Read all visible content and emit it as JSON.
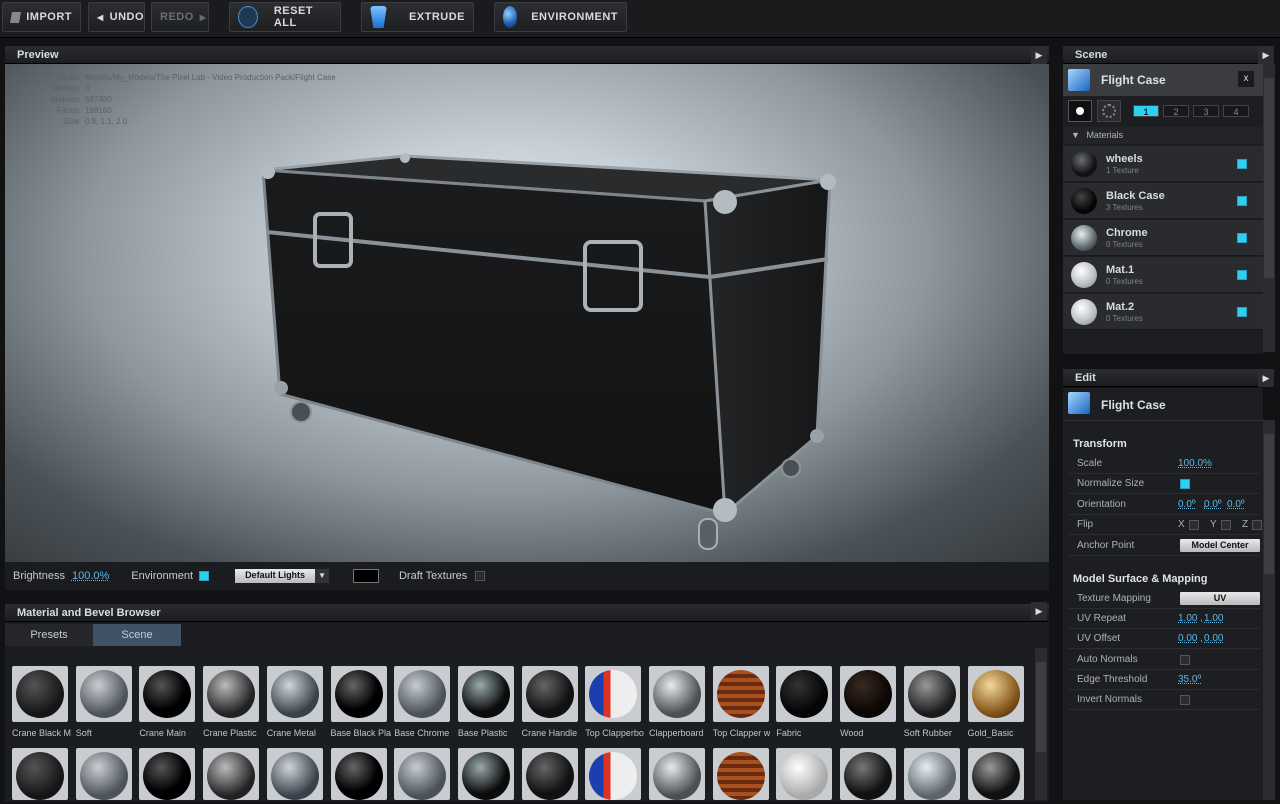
{
  "toolbar": {
    "import": "IMPORT",
    "undo": "UNDO",
    "redo": "REDO",
    "reset_all": "RESET ALL",
    "extrude": "EXTRUDE",
    "environment": "ENVIRONMENT"
  },
  "preview": {
    "title": "Preview",
    "info": [
      {
        "k": "Model:",
        "v": "Models/My_Models/The Pixel Lab - Video Production Pack/Flight Case"
      },
      {
        "k": "Meshes:",
        "v": "3"
      },
      {
        "k": "Vertices:",
        "v": "687480"
      },
      {
        "k": "Faces:",
        "v": "188160"
      },
      {
        "k": "Size:",
        "v": "0.8, 1.1, 2.0"
      }
    ],
    "brightness_label": "Brightness",
    "brightness_value": "100.0%",
    "environment_label": "Environment",
    "lights": "Default Lights",
    "draft_label": "Draft Textures"
  },
  "scene": {
    "title": "Scene",
    "object": "Flight Case",
    "close": "x",
    "pages": [
      "1",
      "2",
      "3",
      "4"
    ],
    "materials_header": "Materials",
    "materials": [
      {
        "name": "wheels",
        "sub": "1 Texture"
      },
      {
        "name": "Black Case",
        "sub": "3 Textures"
      },
      {
        "name": "Chrome",
        "sub": "0 Textures"
      },
      {
        "name": "Mat.1",
        "sub": "0 Textures"
      },
      {
        "name": "Mat.2",
        "sub": "0 Textures"
      }
    ]
  },
  "edit": {
    "title": "Edit",
    "object": "Flight Case",
    "transform": "Transform",
    "scale_label": "Scale",
    "scale": "100.0%",
    "normalize_label": "Normalize Size",
    "orientation_label": "Orientation",
    "orientation": [
      "0.0º",
      "0.0º",
      "0.0º"
    ],
    "flip_label": "Flip",
    "flip": [
      "X",
      "Y",
      "Z"
    ],
    "anchor_label": "Anchor Point",
    "anchor": "Model Center",
    "surface": "Model Surface & Mapping",
    "texmap_label": "Texture Mapping",
    "texmap": "UV",
    "uvrepeat_label": "UV Repeat",
    "uvrepeat": [
      "1.00",
      "1.00"
    ],
    "uvoffset_label": "UV Offset",
    "uvoffset": [
      "0.00",
      "0.00"
    ],
    "autonormals_label": "Auto Normals",
    "edge_label": "Edge Threshold",
    "edge": "35.0º",
    "invert_label": "Invert Normals"
  },
  "browser": {
    "title": "Material and Bevel Browser",
    "tabs": [
      "Presets",
      "Scene"
    ],
    "row1": [
      "Crane Black M",
      "Soft",
      "Crane Main",
      "Crane Plastic",
      "Crane Metal",
      "Base Black Pla",
      "Base Chrome",
      "Base Plastic",
      "Crane Handle",
      "Top Clapperbo",
      "Clapperboard",
      "Top Clapper w",
      "Fabric",
      "Wood",
      "Soft Rubber",
      "Gold_Basic"
    ]
  }
}
